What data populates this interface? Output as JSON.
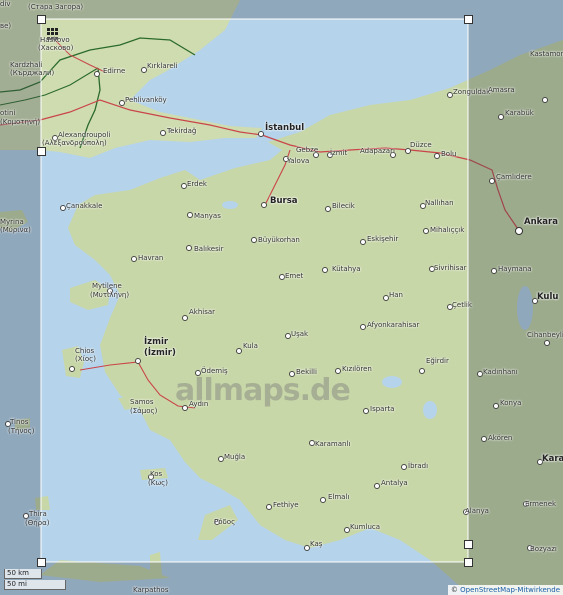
{
  "labels": {
    "ankara": "Ankara",
    "istanbul": "İstanbul",
    "bursa": "Bursa",
    "izmir": "İzmir",
    "izmir2": "(İzmir)",
    "stara": "(Стара Загора)",
    "haskovo": "Haskovo",
    "haskovo2": "(Хасково)",
    "dv": "div",
    "ve": "ве)",
    "kardzhali": "Kardzhali",
    "kardzhali2": "(Кърджали)",
    "edirne": "Edirne",
    "kirklareli": "Kırklareli",
    "pehlivankoy": "Pehlivanköy",
    "komotini": "otini",
    "komotini2": "(Κομοτηνή)",
    "alexandroupoli": "Alexandroupoli",
    "alexandroupoli2": "(Αλεξανδρούπολη)",
    "tekirdag": "Tekirdağ",
    "zonguldak": "Zonguldak",
    "amasra": "Amasra",
    "karabuk": "Karabük",
    "kastamonu": "Kastamonu",
    "gebze": "Gebze",
    "izmit": "İzmit",
    "adapazari": "Adapazarı",
    "duzce": "Düzce",
    "bolu": "Bolu",
    "yalova": "Yalova",
    "camlidere": "Çamlıdere",
    "erdek": "Erdek",
    "canakkale": "Çanakkale",
    "bilecik": "Bilecik",
    "nallihan": "Nallıhan",
    "myrina": "Myrina",
    "myrina2": "(Μύρινα)",
    "manyas": "Manyas",
    "balikesir": "Balıkesir",
    "buyukorhan": "Büyükorhan",
    "eskisehir": "Eskişehir",
    "mihaliccik": "Mihalıççık",
    "havran": "Havran",
    "emet": "Emet",
    "kutahya": "Kütahya",
    "sivrihisar": "Sivrihisar",
    "haymana": "Haymana",
    "mytilene": "Mytilene",
    "mytilene2": "(Μυτιλήνη)",
    "han": "Han",
    "cetlik": "Çetlik",
    "kulu": "Kulu",
    "akhisar": "Akhisar",
    "usak": "Uşak",
    "afyonkarahisar": "Afyonkarahisar",
    "cihanbeyli": "Cihanbeyli",
    "kula": "Kula",
    "chios": "Chios",
    "chios2": "(Χίος)",
    "odemis": "Ödemiş",
    "kizilore": "Kızılören",
    "egirdir": "Eğirdir",
    "kadinhani": "Kadınhanı",
    "bekilli": "Bekilli",
    "samos": "Samos",
    "samos2": "(Σάμος)",
    "aydin": "Aydın",
    "konya": "Konya",
    "isparta": "Isparta",
    "tinos": "Tinos",
    "tinos2": "(Τήνος)",
    "karamanli": "Karamanlı",
    "akoren": "Akören",
    "mugla": "Muğla",
    "karaman": "Karaman",
    "ibradi": "İbradı",
    "kos": "Kos",
    "kos2": "(Κως)",
    "antalya": "Antalya",
    "elmali": "Elmalı",
    "thira": "Thira",
    "thira2": "(Θήρα)",
    "fethiye": "Fethiye",
    "rodos": "Ρόδος",
    "kumluca": "Kumluca",
    "alanya": "Alanya",
    "ermenek": "Ermenek",
    "kas": "Kaş",
    "bozyazi": "Bozyazı",
    "karpathos": "Karpathos",
    "watermark": "allmaps.de"
  },
  "scale": {
    "km": "50 km",
    "mi": "50 mi"
  },
  "attribution": {
    "copyright": "©",
    "link": "OpenStreetMap-Mitwirkende"
  }
}
